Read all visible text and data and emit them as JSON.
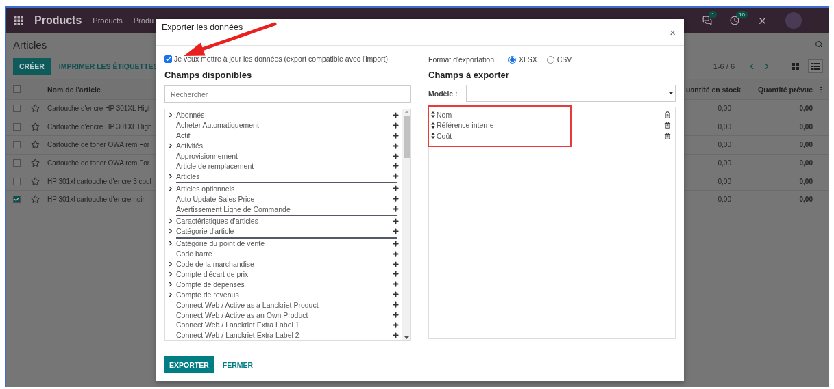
{
  "navbar": {
    "app_title": "Products",
    "menu": [
      "Products",
      "Produ"
    ],
    "notifications": [
      {
        "kind": "chat",
        "count": "1"
      },
      {
        "kind": "activity",
        "count": "10"
      }
    ]
  },
  "control_panel": {
    "title": "Articles",
    "buttons": [
      "CRÉER",
      "IMPRIMER LES ÉTIQUETTES"
    ],
    "pager": "1-6 / 6",
    "views": [
      {
        "kind": "kanban",
        "selected": false
      },
      {
        "kind": "list",
        "selected": true
      }
    ]
  },
  "table": {
    "header_checked": false,
    "columns": [
      "Nom de l'article",
      "uantité en stock",
      "Quantité prévue"
    ],
    "rows": [
      {
        "checked": false,
        "starred": false,
        "name": "Cartouche d'encre HP 301XL High",
        "stock": "0,00",
        "forecast": "0,00"
      },
      {
        "checked": false,
        "starred": false,
        "name": "Cartouche d'encre HP 301XL High",
        "stock": "0,00",
        "forecast": "0,00"
      },
      {
        "checked": false,
        "starred": false,
        "name": "Cartouche de toner OWA rem.For",
        "stock": "0,00",
        "forecast": "0,00"
      },
      {
        "checked": false,
        "starred": false,
        "name": "Cartouche de toner OWA rem.For",
        "stock": "0,00",
        "forecast": "0,00"
      },
      {
        "checked": false,
        "starred": false,
        "name": "HP 301xl cartouche d'encre 3 coul",
        "stock": "0,00",
        "forecast": "0,00"
      },
      {
        "checked": true,
        "starred": false,
        "name": "HP 301xl cartouche d'encre noir",
        "stock": "0,00",
        "forecast": "0,00"
      }
    ]
  },
  "dialog": {
    "title": "Exporter les données",
    "close": "×",
    "compatible": {
      "label": "Je veux mettre à jour les données (export compatible avec l'import)",
      "checked": true
    },
    "available": {
      "heading": "Champs disponibles",
      "search_placeholder": "Rechercher",
      "fields": [
        {
          "label": "Abonnés",
          "expandable": true,
          "divider": false
        },
        {
          "label": "Acheter Automatiquement",
          "expandable": false,
          "divider": false
        },
        {
          "label": "Actif",
          "expandable": false,
          "divider": false
        },
        {
          "label": "Activités",
          "expandable": true,
          "divider": false
        },
        {
          "label": "Approvisionnement",
          "expandable": false,
          "divider": false
        },
        {
          "label": "Article de remplacement",
          "expandable": false,
          "divider": false
        },
        {
          "label": "Articles",
          "expandable": true,
          "divider": true
        },
        {
          "label": "Articles optionnels",
          "expandable": true,
          "divider": false
        },
        {
          "label": "Auto Update Sales Price",
          "expandable": false,
          "divider": false
        },
        {
          "label": "Avertissement Ligne de Commande",
          "expandable": false,
          "divider": true
        },
        {
          "label": "Caractéristiques d'articles",
          "expandable": true,
          "divider": false
        },
        {
          "label": "Catégorie d'article",
          "expandable": true,
          "divider": true
        },
        {
          "label": "Catégorie du point de vente",
          "expandable": true,
          "divider": false
        },
        {
          "label": "Code barre",
          "expandable": false,
          "divider": false
        },
        {
          "label": "Code de la marchandise",
          "expandable": true,
          "divider": false
        },
        {
          "label": "Compte d'écart de prix",
          "expandable": true,
          "divider": false
        },
        {
          "label": "Compte de dépenses",
          "expandable": true,
          "divider": false
        },
        {
          "label": "Compte de revenus",
          "expandable": true,
          "divider": false
        },
        {
          "label": "Connect Web / Active as a Lanckriet Product",
          "expandable": false,
          "divider": false
        },
        {
          "label": "Connect Web / Active as an Own Product",
          "expandable": false,
          "divider": false
        },
        {
          "label": "Connect Web / Lanckriet Extra Label 1",
          "expandable": false,
          "divider": false
        },
        {
          "label": "Connect Web / Lanckriet Extra Label 2",
          "expandable": false,
          "divider": false
        }
      ]
    },
    "format": {
      "label": "Format d'exportation:",
      "options": [
        {
          "label": "XLSX",
          "selected": true
        },
        {
          "label": "CSV",
          "selected": false
        }
      ]
    },
    "export": {
      "heading": "Champs à exporter",
      "template_label": "Modèle :",
      "fields": [
        "Nom",
        "Référence interne",
        "Coût"
      ]
    },
    "buttons": [
      {
        "label": "EXPORTER",
        "kind": "primary"
      },
      {
        "label": "FERMER",
        "kind": "link"
      }
    ]
  }
}
